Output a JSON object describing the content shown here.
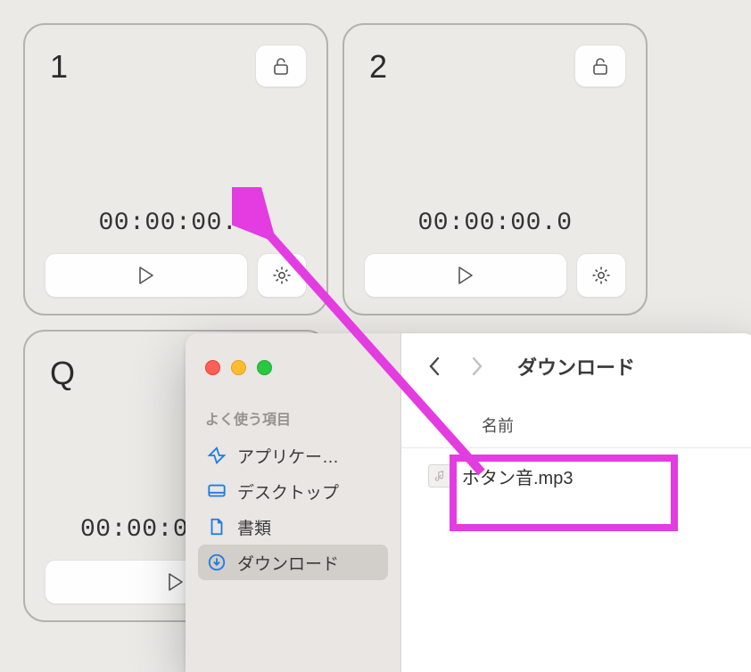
{
  "pads": [
    {
      "label": "1",
      "time": "00:00:00.0"
    },
    {
      "label": "2",
      "time": "00:00:00.0"
    },
    {
      "label": "Q",
      "time": "00:00:00"
    }
  ],
  "finder": {
    "sidebar": {
      "section_header": "よく使う項目",
      "items": [
        {
          "label": "アプリケー…",
          "icon": "apps"
        },
        {
          "label": "デスクトップ",
          "icon": "desktop"
        },
        {
          "label": "書類",
          "icon": "doc"
        },
        {
          "label": "ダウンロード",
          "icon": "download",
          "selected": true
        }
      ]
    },
    "title": "ダウンロード",
    "column_header": "名前",
    "files": [
      {
        "name": "ボタン音.mp3"
      }
    ]
  },
  "colors": {
    "accent_blue": "#1E7DE0",
    "annotation": "#E33CE0"
  }
}
